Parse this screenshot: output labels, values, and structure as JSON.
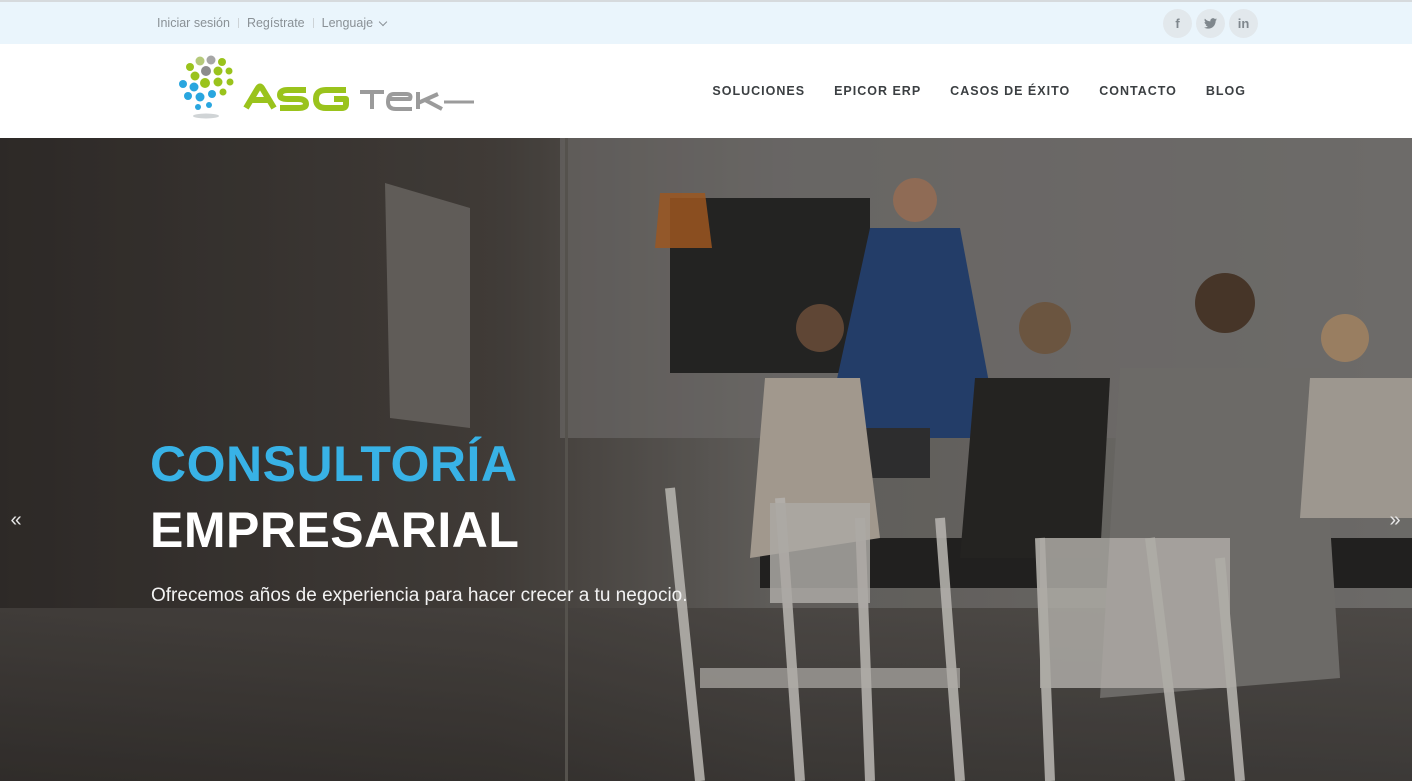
{
  "topbar": {
    "login": "Iniciar sesión",
    "register": "Regístrate",
    "language": "Lenguaje",
    "social": {
      "facebook": "f",
      "twitter": "twitter-icon",
      "linkedin": "in"
    }
  },
  "header": {
    "logo_text": "ASG Tek",
    "nav": [
      "SOLUCIONES",
      "EPICOR ERP",
      "CASOS DE ÉXITO",
      "CONTACTO",
      "BLOG"
    ]
  },
  "hero": {
    "title_line1": "CONSULTORÍA",
    "title_line2": "EMPRESARIAL",
    "subtitle": "Ofrecemos años de experiencia para hacer crecer a tu negocio.",
    "prev": "«",
    "next": "»"
  },
  "colors": {
    "accent_blue": "#38b2e6",
    "brand_green": "#9ac31c",
    "topbar_bg": "#eaf5fc"
  }
}
